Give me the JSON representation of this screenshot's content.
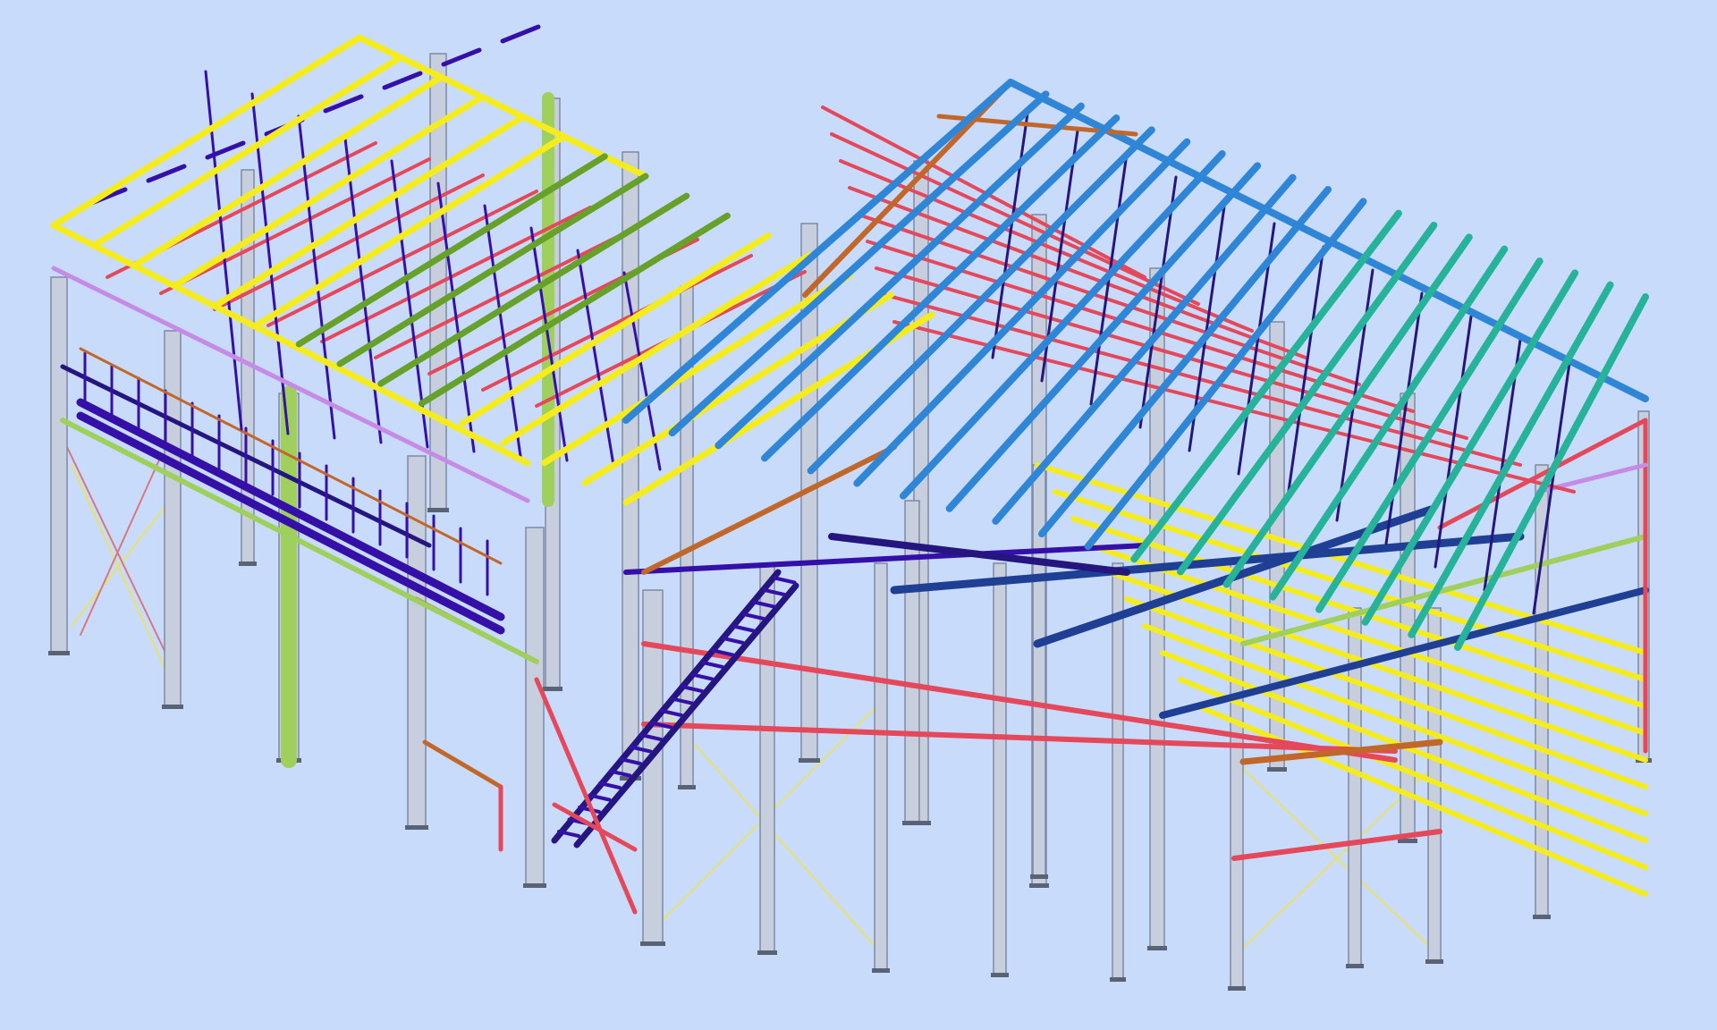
{
  "viewport": {
    "background": "#c9dbfa"
  },
  "palette": {
    "column": "#c7cede",
    "column_edge": "#7f8aa3",
    "rafter_indigo": "#3410a8",
    "purlin_yellow": "#f5ec1e",
    "purlin_green": "#66a12a",
    "purlin_blue": "#2f86d6",
    "purlin_teal": "#27b39a",
    "beam_red": "#e4485a",
    "beam_orange": "#c2672a",
    "bracing_pink": "#d77780",
    "bracing_yellow": "#e8e26a",
    "beam_navy": "#1f3f94",
    "tie_lilac": "#c58be6",
    "lime": "#9fcf5c",
    "truss_navy": "#24167e",
    "cable_silver": "#b9bfcb"
  }
}
